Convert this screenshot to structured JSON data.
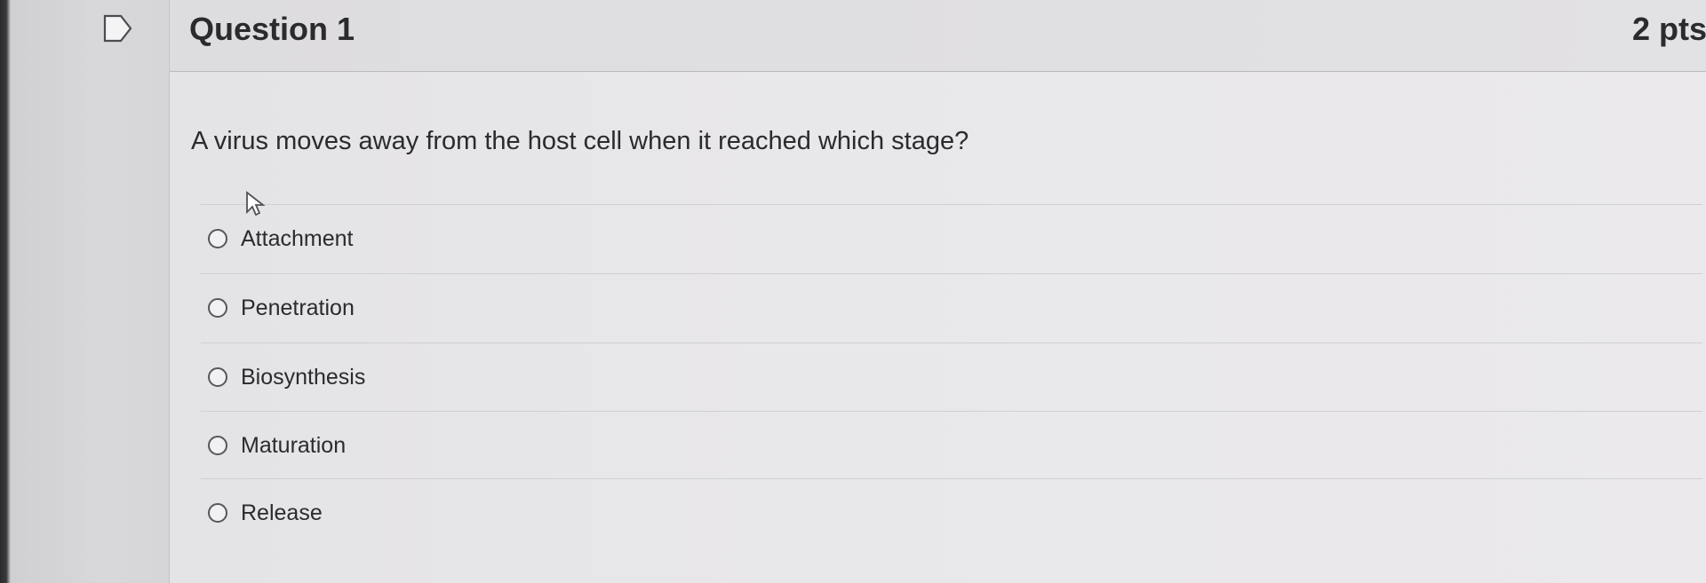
{
  "question": {
    "title": "Question 1",
    "points": "2 pts",
    "text": "A virus moves away from the host cell when it reached which stage?"
  },
  "answers": [
    {
      "label": "Attachment",
      "selected": false
    },
    {
      "label": "Penetration",
      "selected": false
    },
    {
      "label": "Biosynthesis",
      "selected": false
    },
    {
      "label": "Maturation",
      "selected": false
    },
    {
      "label": "Release",
      "selected": false
    }
  ],
  "icons": {
    "flag": "flag-question-icon",
    "cursor": "mouse-pointer-icon",
    "radio": "radio-unselected-icon"
  },
  "colors": {
    "text": "#2b2b2d",
    "background": "#e6e5e7",
    "divider": "#cfd0d3"
  }
}
